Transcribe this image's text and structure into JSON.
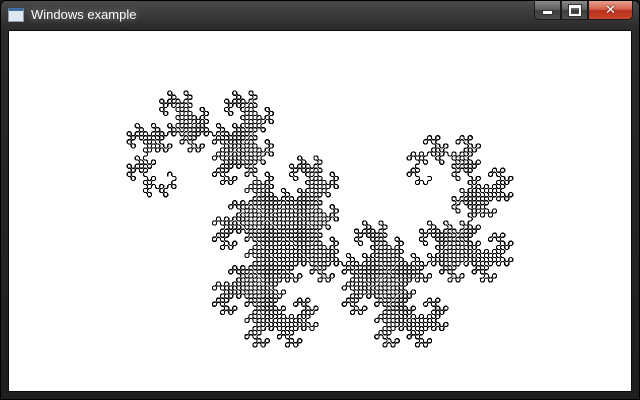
{
  "window": {
    "title": "Windows example",
    "icon": "app-window-icon"
  },
  "controls": {
    "minimize_icon": "minimize-icon",
    "maximize_icon": "maximize-icon",
    "close_icon": "close-icon",
    "close_glyph": "✕"
  },
  "canvas": {
    "figure": "dragon-curve",
    "iterations": 12,
    "stroke_color": "#000000",
    "background_color": "#ffffff"
  }
}
